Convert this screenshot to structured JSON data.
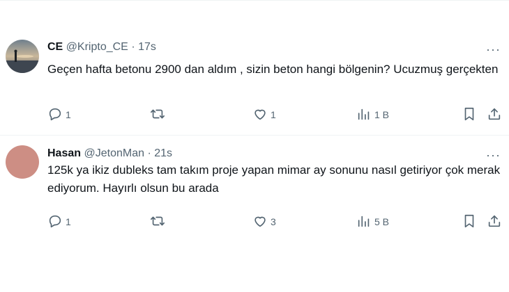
{
  "tweets": [
    {
      "name": "CE",
      "handle": "@Kripto_CE",
      "separator": "·",
      "time": "17s",
      "text": "Geçen hafta betonu 2900 dan aldım , sizin beton hangi  bölgenin? Ucuzmuş gerçekten",
      "replies": "1",
      "retweets": "",
      "likes": "1",
      "views": "1 B",
      "more": "···"
    },
    {
      "name": "Hasan",
      "handle": "@JetonMan",
      "separator": "·",
      "time": "21s",
      "text": "125k ya ikiz dubleks tam takım proje yapan mimar ay sonunu nasıl getiriyor çok merak ediyorum. Hayırlı olsun bu arada",
      "replies": "1",
      "retweets": "",
      "likes": "3",
      "views": "5 B",
      "more": "···"
    }
  ],
  "colors": {
    "text_primary": "#0f1419",
    "text_secondary": "#536471",
    "divider": "#eff3f4",
    "avatar_2": "#cd8e84"
  },
  "icons": [
    "reply-icon",
    "retweet-icon",
    "like-icon",
    "views-icon",
    "bookmark-icon",
    "share-icon",
    "more-icon"
  ]
}
